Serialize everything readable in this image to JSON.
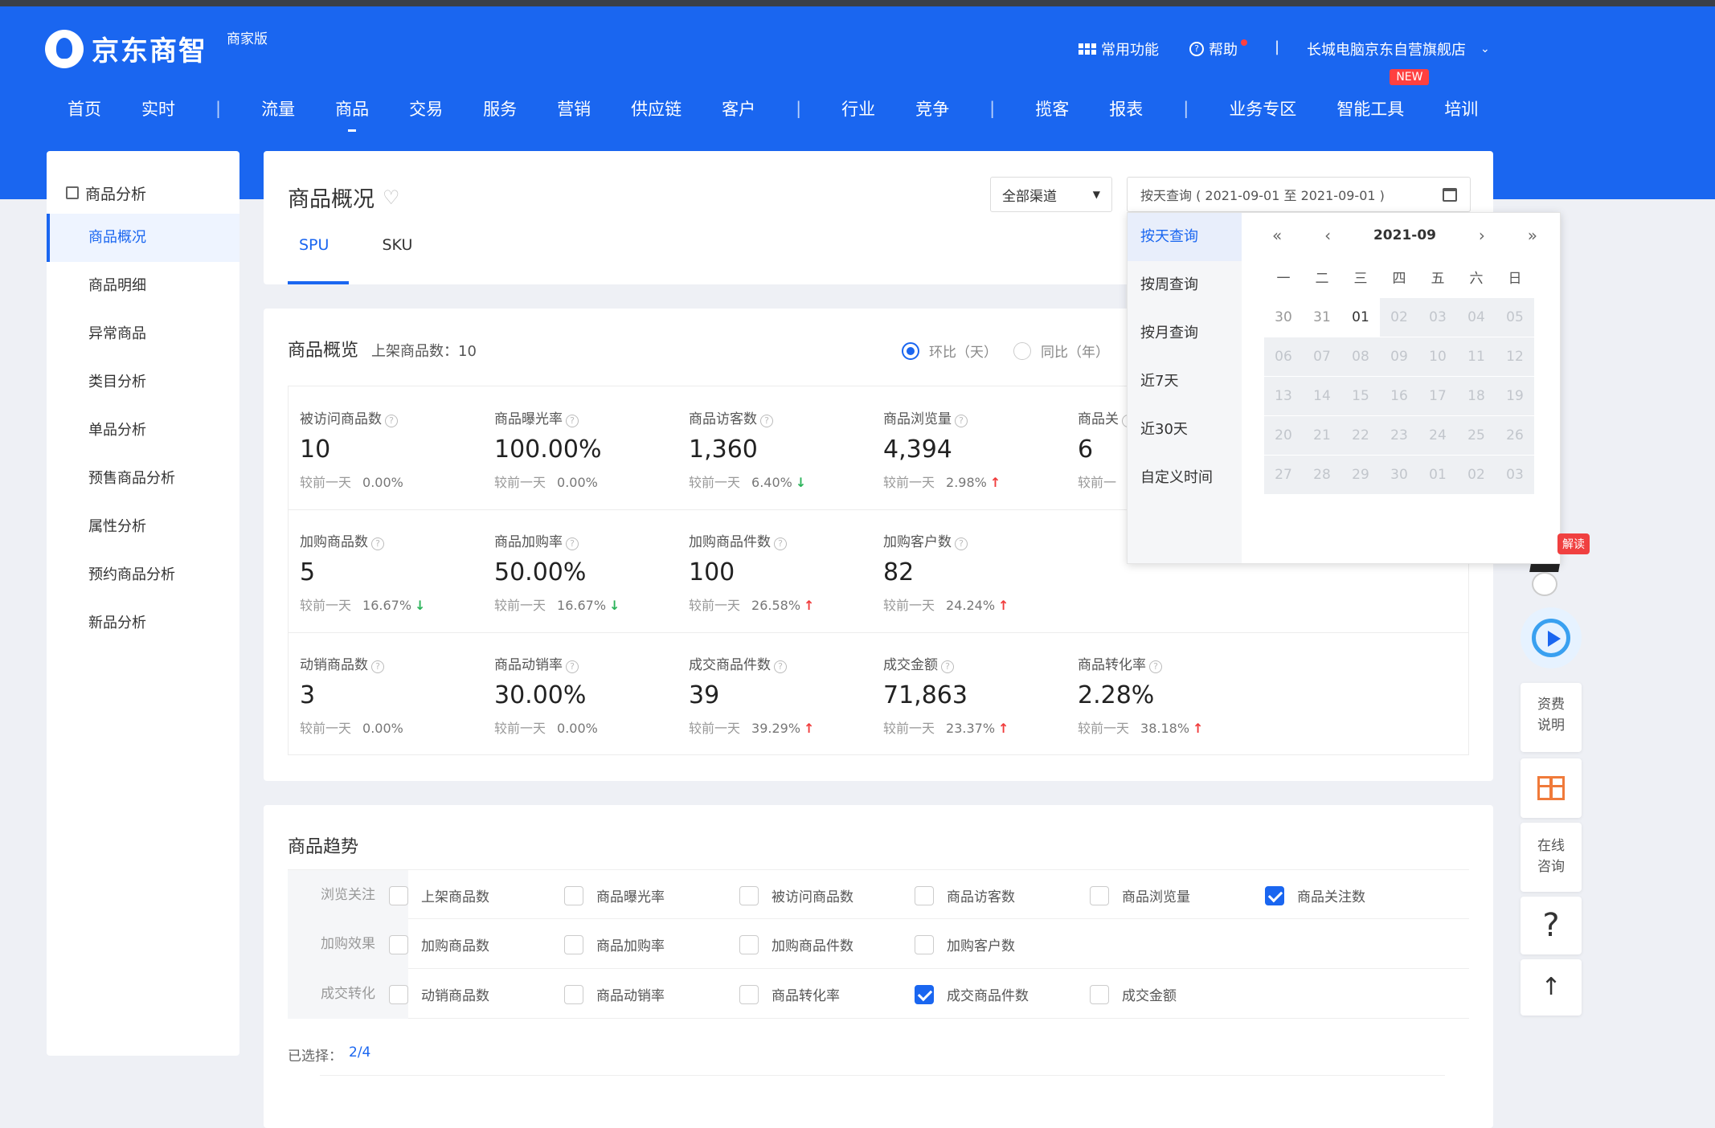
{
  "brand": {
    "name": "京东商智",
    "edition": "商家版"
  },
  "header": {
    "common_functions": "常用功能",
    "help": "帮助",
    "shop_name": "长城电脑京东自营旗舰店"
  },
  "nav": [
    {
      "label": "首页"
    },
    {
      "label": "实时"
    },
    {
      "sep": "|"
    },
    {
      "label": "流量"
    },
    {
      "label": "商品",
      "active": true
    },
    {
      "label": "交易"
    },
    {
      "label": "服务"
    },
    {
      "label": "营销"
    },
    {
      "label": "供应链"
    },
    {
      "label": "客户"
    },
    {
      "sep": "|"
    },
    {
      "label": "行业"
    },
    {
      "label": "竞争"
    },
    {
      "sep": "|"
    },
    {
      "label": "揽客"
    },
    {
      "label": "报表"
    },
    {
      "sep": "|"
    },
    {
      "label": "业务专区"
    },
    {
      "label": "智能工具",
      "badge": "NEW"
    },
    {
      "label": "培训"
    }
  ],
  "sidebar": {
    "title": "商品分析",
    "items": [
      "商品概况",
      "商品明细",
      "异常商品",
      "类目分析",
      "单品分析",
      "预售商品分析",
      "属性分析",
      "预约商品分析",
      "新品分析"
    ],
    "active_index": 0
  },
  "page": {
    "title": "商品概况",
    "channel": "全部渠道",
    "date_query": "按天查询 ( 2021-09-01 至 2021-09-01 )",
    "tabs": [
      "SPU",
      "SKU"
    ],
    "active_tab": 0
  },
  "overview": {
    "title": "商品概览",
    "listed_label": "上架商品数：10",
    "compare_options": [
      "环比（天）",
      "同比（年）"
    ],
    "rows": [
      [
        {
          "label": "被访问商品数",
          "value": "10",
          "cmp": "较前一天",
          "pct": "0.00%",
          "dir": ""
        },
        {
          "label": "商品曝光率",
          "value": "100.00%",
          "cmp": "较前一天",
          "pct": "0.00%",
          "dir": ""
        },
        {
          "label": "商品访客数",
          "value": "1,360",
          "cmp": "较前一天",
          "pct": "6.40%",
          "dir": "down"
        },
        {
          "label": "商品浏览量",
          "value": "4,394",
          "cmp": "较前一天",
          "pct": "2.98%",
          "dir": "up"
        },
        {
          "label": "商品关",
          "value": "6",
          "cmp": "较前一",
          "pct": "",
          "dir": ""
        }
      ],
      [
        {
          "label": "加购商品数",
          "value": "5",
          "cmp": "较前一天",
          "pct": "16.67%",
          "dir": "down"
        },
        {
          "label": "商品加购率",
          "value": "50.00%",
          "cmp": "较前一天",
          "pct": "16.67%",
          "dir": "down"
        },
        {
          "label": "加购商品件数",
          "value": "100",
          "cmp": "较前一天",
          "pct": "26.58%",
          "dir": "up"
        },
        {
          "label": "加购客户数",
          "value": "82",
          "cmp": "较前一天",
          "pct": "24.24%",
          "dir": "up"
        }
      ],
      [
        {
          "label": "动销商品数",
          "value": "3",
          "cmp": "较前一天",
          "pct": "0.00%",
          "dir": ""
        },
        {
          "label": "商品动销率",
          "value": "30.00%",
          "cmp": "较前一天",
          "pct": "0.00%",
          "dir": ""
        },
        {
          "label": "成交商品件数",
          "value": "39",
          "cmp": "较前一天",
          "pct": "39.29%",
          "dir": "up"
        },
        {
          "label": "成交金额",
          "value": "71,863",
          "cmp": "较前一天",
          "pct": "23.37%",
          "dir": "up"
        },
        {
          "label": "商品转化率",
          "value": "2.28%",
          "cmp": "较前一天",
          "pct": "38.18%",
          "dir": "up"
        }
      ]
    ]
  },
  "calendar": {
    "modes": [
      "按天查询",
      "按周查询",
      "按月查询",
      "近7天",
      "近30天",
      "自定义时间"
    ],
    "active_mode": 0,
    "month": "2021-09",
    "weekdays": [
      "一",
      "二",
      "三",
      "四",
      "五",
      "六",
      "日"
    ],
    "days": [
      [
        "30",
        "31",
        "01",
        "02",
        "03",
        "04",
        "05"
      ],
      [
        "06",
        "07",
        "08",
        "09",
        "10",
        "11",
        "12"
      ],
      [
        "13",
        "14",
        "15",
        "16",
        "17",
        "18",
        "19"
      ],
      [
        "20",
        "21",
        "22",
        "23",
        "24",
        "25",
        "26"
      ],
      [
        "27",
        "28",
        "29",
        "30",
        "01",
        "02",
        "03"
      ]
    ],
    "selected_day": "01"
  },
  "trend": {
    "title": "商品趋势",
    "groups": [
      {
        "name": "浏览关注",
        "options": [
          {
            "label": "上架商品数",
            "checked": false
          },
          {
            "label": "商品曝光率",
            "checked": false
          },
          {
            "label": "被访问商品数",
            "checked": false
          },
          {
            "label": "商品访客数",
            "checked": false
          },
          {
            "label": "商品浏览量",
            "checked": false
          },
          {
            "label": "商品关注数",
            "checked": true
          }
        ]
      },
      {
        "name": "加购效果",
        "options": [
          {
            "label": "加购商品数",
            "checked": false
          },
          {
            "label": "商品加购率",
            "checked": false
          },
          {
            "label": "加购商品件数",
            "checked": false
          },
          {
            "label": "加购客户数",
            "checked": false
          }
        ]
      },
      {
        "name": "成交转化",
        "options": [
          {
            "label": "动销商品数",
            "checked": false
          },
          {
            "label": "商品动销率",
            "checked": false
          },
          {
            "label": "商品转化率",
            "checked": false
          },
          {
            "label": "成交商品件数",
            "checked": true
          },
          {
            "label": "成交金额",
            "checked": false
          }
        ]
      }
    ],
    "selected_label": "已选择：",
    "selected_count": "2/4"
  },
  "right_tools": {
    "read_badge": "解读",
    "fee": "资费说明",
    "consult": "在线咨询",
    "question": "?",
    "top": "↑"
  },
  "colors": {
    "primary": "#1a66f0",
    "up": "#f03c3c",
    "down": "#2bb35a"
  }
}
